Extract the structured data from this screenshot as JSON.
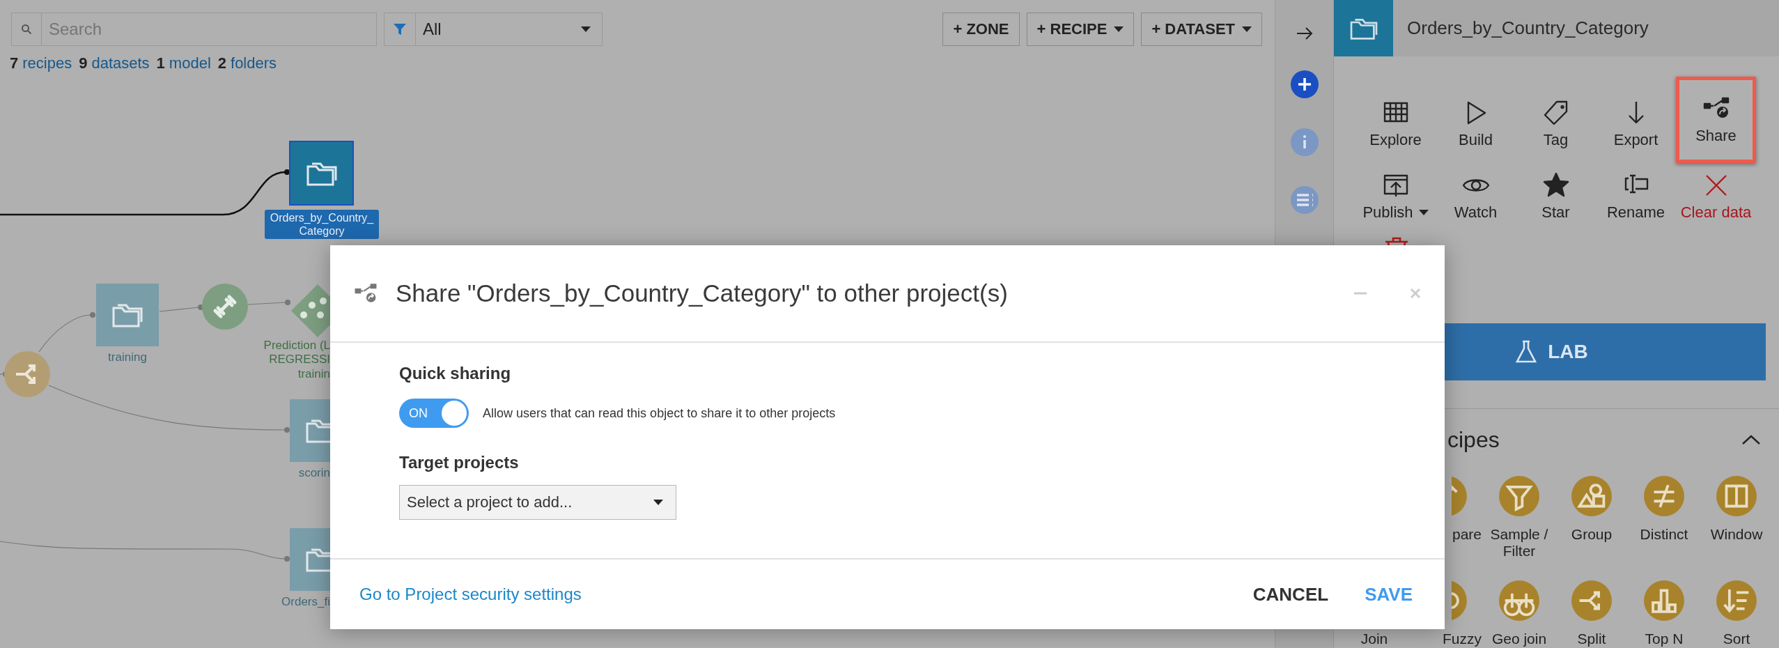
{
  "toolbar": {
    "search": {
      "placeholder": "Search"
    },
    "filter": {
      "value": "All"
    },
    "buttons": [
      {
        "label": "+ ZONE",
        "dropdown": false
      },
      {
        "label": "+ RECIPE",
        "dropdown": true
      },
      {
        "label": "+ DATASET",
        "dropdown": true
      }
    ]
  },
  "counts": [
    {
      "number": "7",
      "label": "recipes"
    },
    {
      "number": "9",
      "label": "datasets"
    },
    {
      "number": "1",
      "label": "model"
    },
    {
      "number": "2",
      "label": "folders"
    }
  ],
  "flow": {
    "nodes": [
      {
        "kind": "folder",
        "label": [
          "Orders_by_Country_",
          "Category"
        ],
        "selected": true
      },
      {
        "kind": "folder",
        "label": [
          "training"
        ],
        "selected": false
      },
      {
        "kind": "train"
      },
      {
        "kind": "model",
        "label": [
          "Prediction (L",
          "REGRESSI",
          "trainin"
        ]
      },
      {
        "kind": "split"
      },
      {
        "kind": "folder",
        "label": [
          "scorin"
        ],
        "selected": false
      },
      {
        "kind": "folder",
        "label": [
          "Orders_fi"
        ],
        "selected": false
      }
    ]
  },
  "panel": {
    "title": "Orders_by_Country_Category",
    "actions": [
      {
        "label": "Explore",
        "highlighted": false,
        "danger": false,
        "dropdown": false
      },
      {
        "label": "Build",
        "highlighted": false,
        "danger": false,
        "dropdown": false
      },
      {
        "label": "Tag",
        "highlighted": false,
        "danger": false,
        "dropdown": false
      },
      {
        "label": "Export",
        "highlighted": false,
        "danger": false,
        "dropdown": false
      },
      {
        "label": "Share",
        "highlighted": true,
        "danger": false,
        "dropdown": false
      },
      {
        "label": "Publish",
        "highlighted": false,
        "danger": false,
        "dropdown": true
      },
      {
        "label": "Watch",
        "highlighted": false,
        "danger": false,
        "dropdown": false
      },
      {
        "label": "Star",
        "highlighted": false,
        "danger": false,
        "dropdown": false
      },
      {
        "label": "Rename",
        "highlighted": false,
        "danger": false,
        "dropdown": false
      },
      {
        "label": "Clear data",
        "highlighted": false,
        "danger": true,
        "dropdown": false
      }
    ],
    "lab_button": "LAB",
    "recipes": {
      "title": "cipes",
      "expanded": true,
      "items": [
        "pare",
        "Sample / Filter",
        "Group",
        "Distinct",
        "Window",
        "Join",
        "Fuzzy",
        "Geo join",
        "Split",
        "Top N",
        "Sort"
      ]
    }
  },
  "modal": {
    "title": "Share \"Orders_by_Country_Category\" to other project(s)",
    "quick_sharing": {
      "heading": "Quick sharing",
      "on": true,
      "state_label": "ON",
      "description": "Allow users that can read this object to share it to other projects"
    },
    "target_projects": {
      "heading": "Target projects",
      "placeholder": "Select a project to add..."
    },
    "link": "Go to Project security settings",
    "buttons": [
      {
        "label": "CANCEL",
        "kind": "secondary"
      },
      {
        "label": "SAVE",
        "kind": "primary"
      }
    ]
  }
}
